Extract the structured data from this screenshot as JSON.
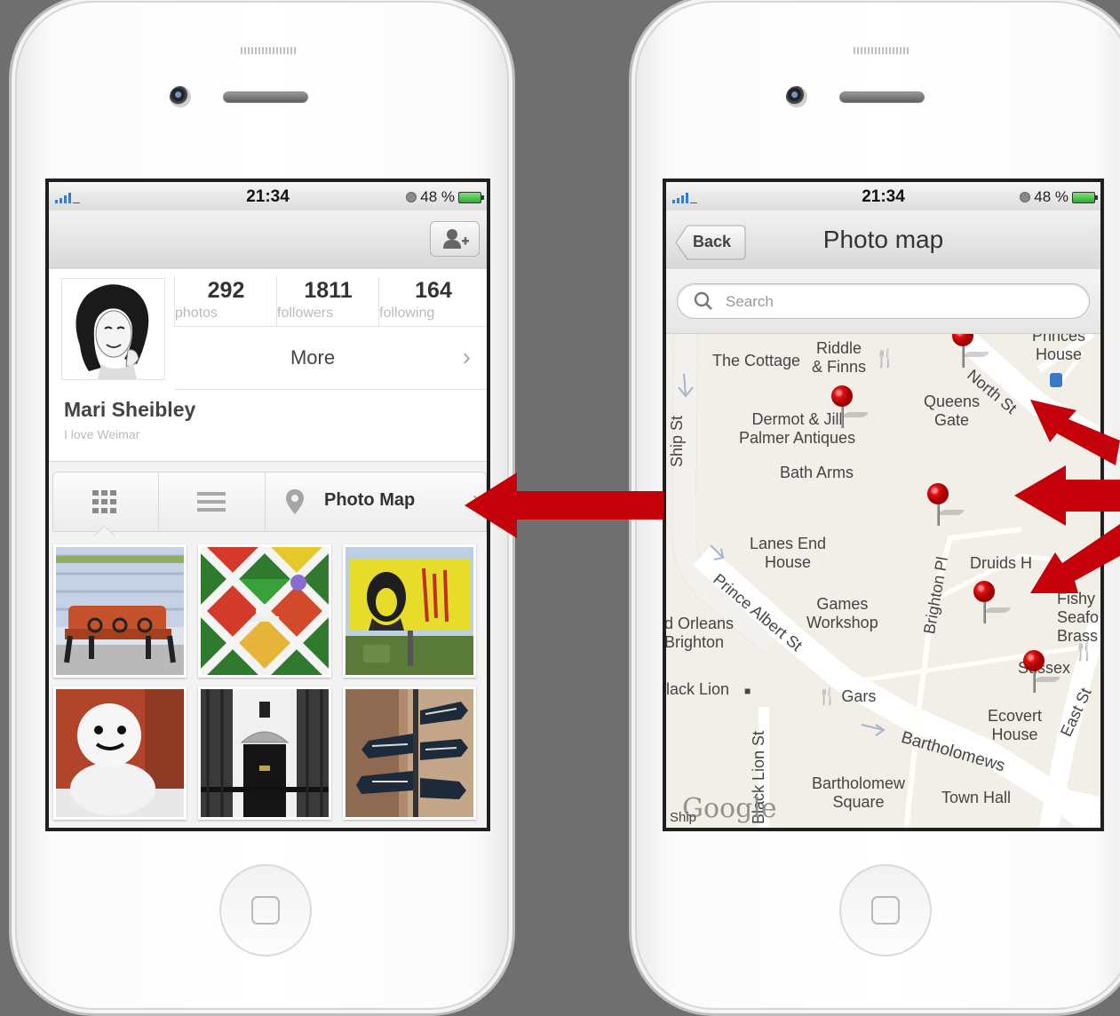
{
  "left_phone": {
    "status": {
      "time": "21:34",
      "battery": "48 %"
    },
    "stats": [
      {
        "value": "292",
        "label": "photos"
      },
      {
        "value": "1811",
        "label": "followers"
      },
      {
        "value": "164",
        "label": "following"
      }
    ],
    "more_label": "More",
    "user": {
      "name": "Mari Sheibley",
      "bio": "I love Weimar"
    },
    "tabs": {
      "photo_map_label": "Photo Map"
    },
    "icons": [
      "add-user-icon",
      "grid-icon",
      "list-icon",
      "map-pin-icon",
      "chevron-right-icon"
    ]
  },
  "right_phone": {
    "status": {
      "time": "21:34",
      "battery": "48 %"
    },
    "back_label": "Back",
    "title": "Photo map",
    "search": {
      "placeholder": "Search"
    },
    "map_labels": {
      "cottage": "The Cottage",
      "riddle": "Riddle\n& Finns",
      "princes": "Princes\nHouse",
      "north": "North St",
      "queens": "Queens\nGate",
      "dermot": "Dermot & Jill\nPalmer Antiques",
      "ship_st": "Ship St",
      "bath": "Bath Arms",
      "lanes": "Lanes End\nHouse",
      "druids": "Druids H",
      "brighton_pl": "Brighton Pl",
      "prince_albert": "Prince Albert St",
      "games": "Games\nWorkshop",
      "orleans": "d Orleans\nBrighton",
      "fishy": "Fishy\nSeafo\nBrass",
      "sussex": "Sussex",
      "lion": "lack Lion",
      "gars": "Gars",
      "ecovert": "Ecovert\nHouse",
      "east": "East St",
      "bartholomews": "Bartholomews",
      "black_lion_st": "Black Lion St",
      "bartholomew_sq": "Bartholomew\nSquare",
      "town_hall": "Town Hall",
      "google": "Google",
      "ship": "Ship"
    },
    "pin_count": 5
  },
  "colors": {
    "arrow": "#c4000a",
    "pin": "#e01010",
    "background": "#6f6f6f"
  }
}
